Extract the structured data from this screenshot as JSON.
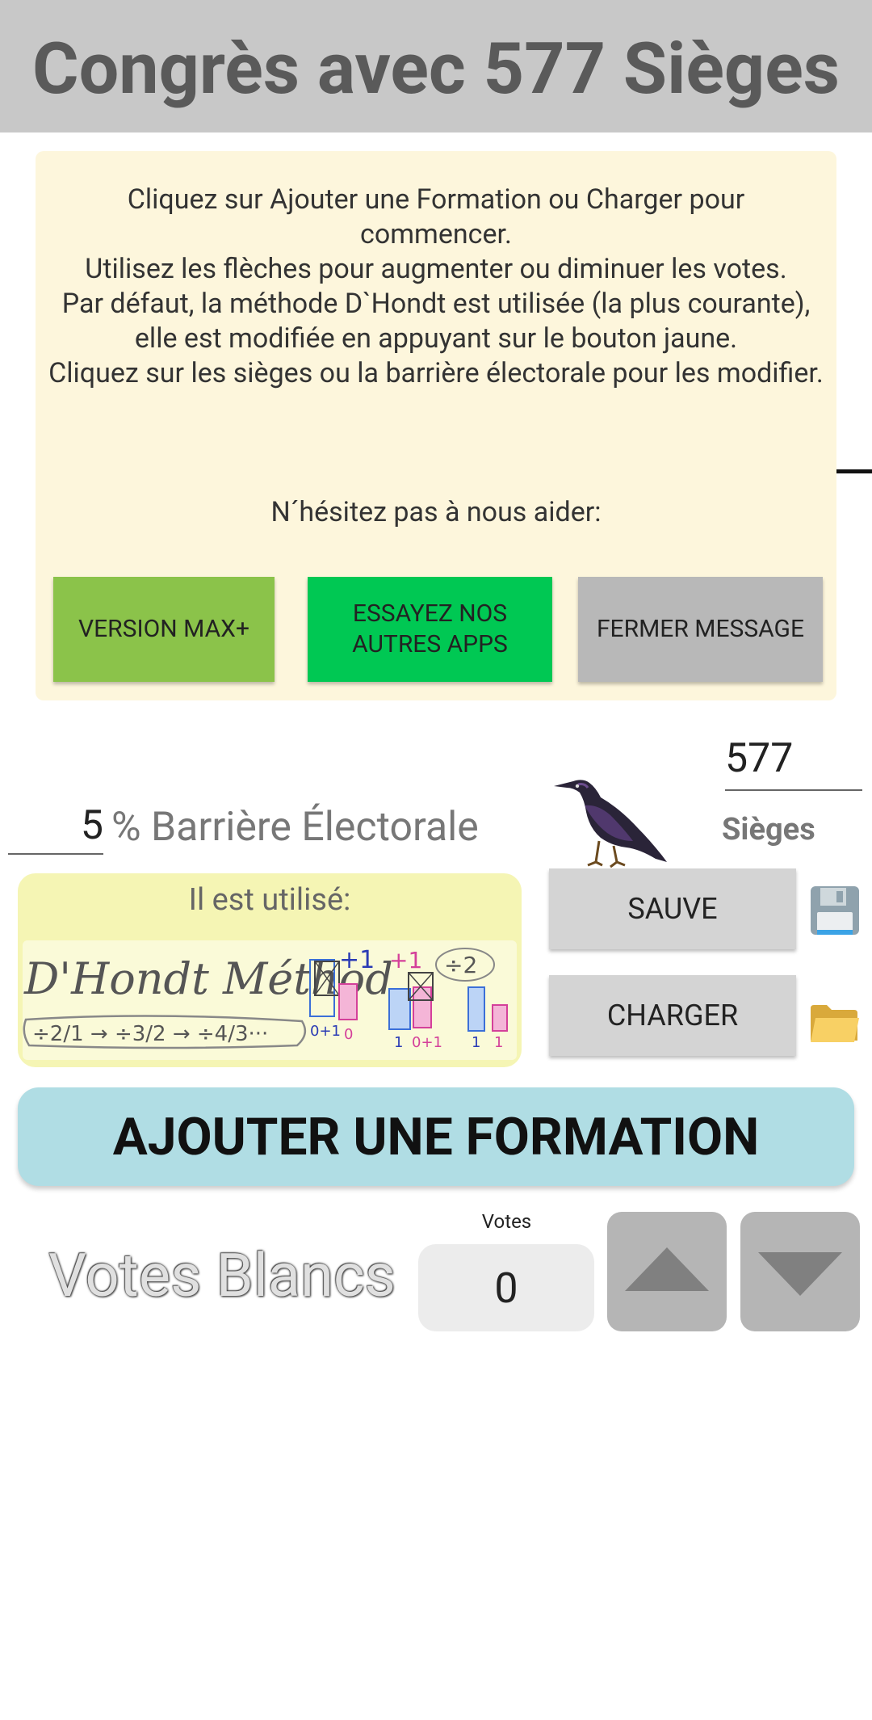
{
  "header": {
    "title": "Congrès avec 577 Sièges"
  },
  "message": {
    "lines": [
      "Cliquez sur Ajouter une Formation ou Charger pour commencer.",
      "Utilisez les flèches pour augmenter ou diminuer les votes.",
      "Par défaut, la méthode D`Hondt est utilisée (la plus courante), elle est modifiée en appuyant sur le bouton jaune.",
      "Cliquez sur les sièges ou la barrière électorale pour les modifier."
    ],
    "help": "N´hésitez pas à nous aider:",
    "buttons": {
      "max": "VERSION MAX+",
      "apps": "ESSAYEZ NOS AUTRES APPS",
      "close": "FERMER MESSAGE"
    }
  },
  "seats": {
    "value": "577",
    "label": "Sièges"
  },
  "threshold": {
    "value": "5",
    "label": "% Barrière Électorale"
  },
  "method": {
    "title": "Il est utilisé:",
    "image_text": {
      "name": "D'Hondt Méthod",
      "sequence": "÷2/1 → ÷3/2 → ÷4/3···",
      "plus1a": "+1",
      "plus1b": "+1",
      "div2": "÷2",
      "lbl_a": "0+1",
      "lbl_b": "0",
      "lbl_c": "1",
      "lbl_d": "0+1",
      "lbl_e": "1",
      "lbl_f": "1"
    }
  },
  "actions": {
    "save": "SAUVE",
    "load": "CHARGER"
  },
  "add_formation": "AJOUTER UNE FORMATION",
  "blank_votes": {
    "label": "Votes Blancs",
    "caption": "Votes",
    "value": "0"
  },
  "icons": {
    "bird": "starling-bird-icon",
    "save": "floppy-disk-icon",
    "load": "folder-icon",
    "up": "arrow-up-icon",
    "down": "arrow-down-icon"
  },
  "colors": {
    "header_bg": "#c8c8c8",
    "message_bg": "#fdf6dc",
    "max_btn": "#8bc34a",
    "apps_btn": "#00c853",
    "close_btn": "#b8b8b8",
    "method_panel": "#f5f5b4",
    "add_btn": "#b0dde4"
  }
}
